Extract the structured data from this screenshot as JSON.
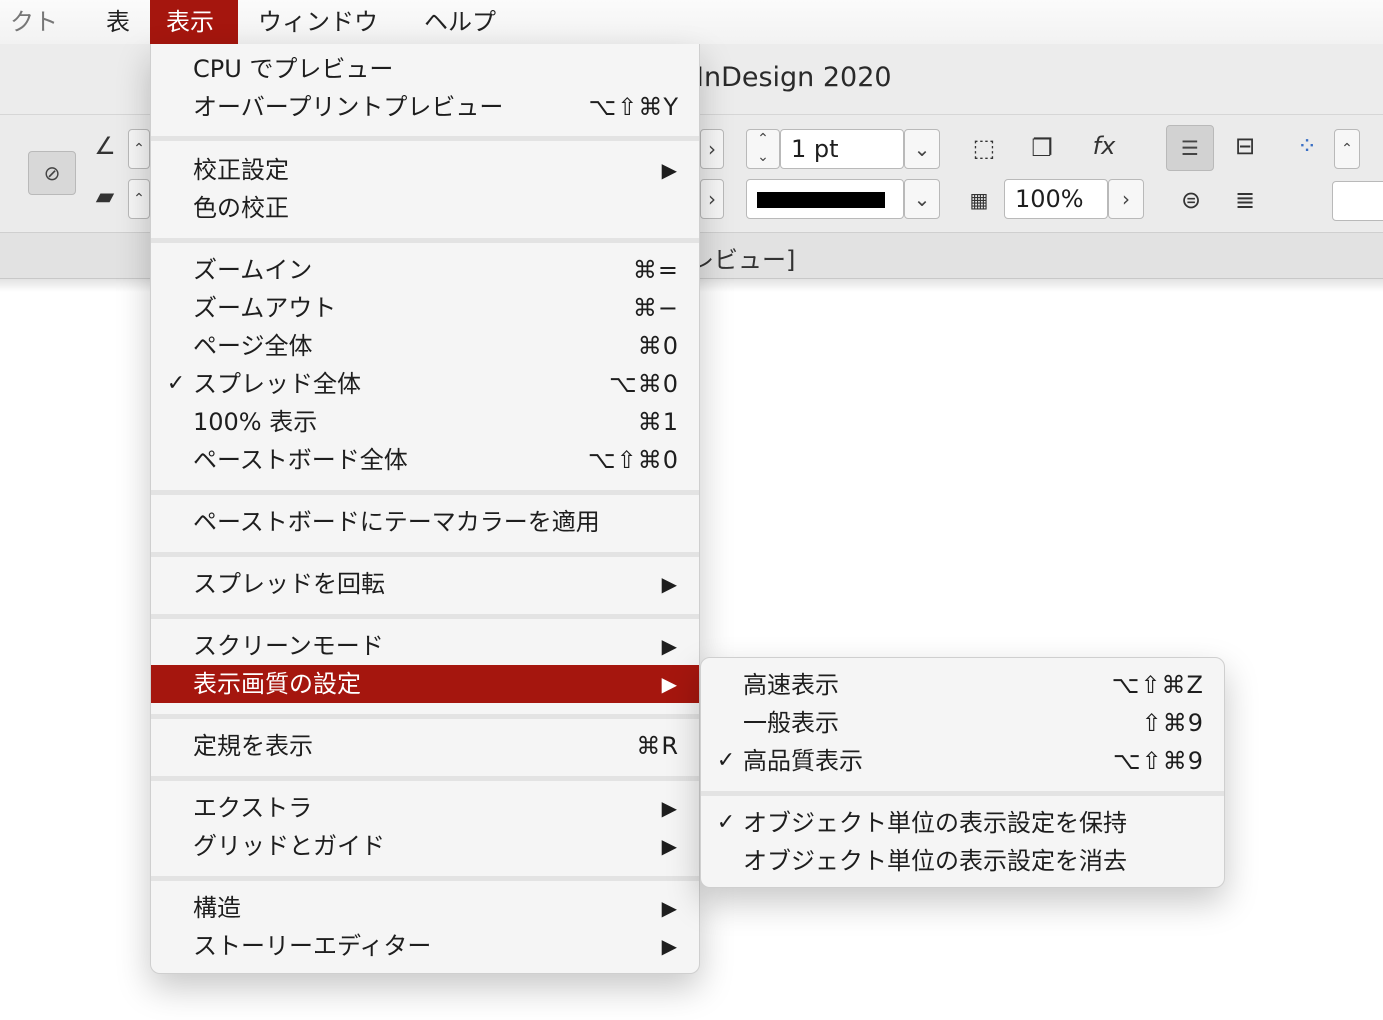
{
  "menubar": {
    "items": [
      {
        "label": "クト"
      },
      {
        "label": "表"
      },
      {
        "label": "表示"
      },
      {
        "label": "ウィンドウ"
      },
      {
        "label": "ヘルプ"
      }
    ]
  },
  "window": {
    "title": "InDesign 2020",
    "tab_text": "レビュー]",
    "stroke_weight": "1 pt",
    "opacity": "100%"
  },
  "menu": {
    "items": {
      "cpu_preview": {
        "label": "CPU でプレビュー",
        "shortcut": ""
      },
      "overprint_preview": {
        "label": "オーバープリントプレビュー",
        "shortcut": "⌥⇧⌘Y"
      },
      "proof_setup": {
        "label": "校正設定"
      },
      "proof_colors": {
        "label": "色の校正"
      },
      "zoom_in": {
        "label": "ズームイン",
        "shortcut": "⌘="
      },
      "zoom_out": {
        "label": "ズームアウト",
        "shortcut": "⌘−"
      },
      "fit_page": {
        "label": "ページ全体",
        "shortcut": "⌘0"
      },
      "fit_spread": {
        "label": "スプレッド全体",
        "shortcut": "⌥⌘0",
        "checked": true
      },
      "actual_size": {
        "label": "100% 表示",
        "shortcut": "⌘1"
      },
      "entire_pasteboard": {
        "label": "ペーストボード全体",
        "shortcut": "⌥⇧⌘0"
      },
      "theme_color": {
        "label": "ペーストボードにテーマカラーを適用"
      },
      "rotate_spread": {
        "label": "スプレッドを回転"
      },
      "screen_mode": {
        "label": "スクリーンモード"
      },
      "display_performance": {
        "label": "表示画質の設定"
      },
      "show_rulers": {
        "label": "定規を表示",
        "shortcut": "⌘R"
      },
      "extras": {
        "label": "エクストラ"
      },
      "grids_guides": {
        "label": "グリッドとガイド"
      },
      "structure": {
        "label": "構造"
      },
      "story_editor": {
        "label": "ストーリーエディター"
      }
    }
  },
  "submenu": {
    "items": {
      "fast_display": {
        "label": "高速表示",
        "shortcut": "⌥⇧⌘Z"
      },
      "typical_display": {
        "label": "一般表示",
        "shortcut": "⇧⌘9"
      },
      "high_quality": {
        "label": "高品質表示",
        "shortcut": "⌥⇧⌘9",
        "checked": true
      },
      "allow_object_level": {
        "label": "オブジェクト単位の表示設定を保持",
        "checked": true
      },
      "clear_object_level": {
        "label": "オブジェクト単位の表示設定を消去"
      }
    }
  },
  "glyphs": {
    "check": "✓",
    "arrow": "▶"
  },
  "colors": {
    "highlight": "#a5160e",
    "menu_bg": "#f5f5f5",
    "separator": "#e3e3e3"
  }
}
